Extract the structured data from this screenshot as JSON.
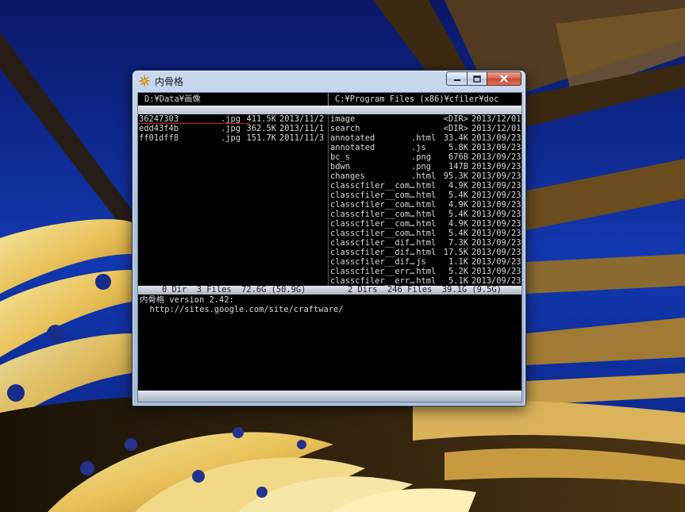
{
  "window": {
    "title": "内骨格"
  },
  "left_pane": {
    "path": "D:¥Data¥画像",
    "files": [
      {
        "name": "36247303",
        "ext": ".jpg",
        "size": "411.5K",
        "date": "2013/11/2"
      },
      {
        "name": "edd43f4b",
        "ext": ".jpg",
        "size": "362.5K",
        "date": "2013/11/1"
      },
      {
        "name": "ff01dff8",
        "ext": ".jpg",
        "size": "151.7K",
        "date": "2011/11/3"
      }
    ],
    "status": "0 Dir  3 Files  72.6G (50.9G)"
  },
  "right_pane": {
    "path": "C:¥Program Files (x86)¥cfiler¥doc",
    "files": [
      {
        "name": "image",
        "ext": "",
        "size": "<DIR>",
        "date": "2013/12/01"
      },
      {
        "name": "search",
        "ext": "",
        "size": "<DIR>",
        "date": "2013/12/01"
      },
      {
        "name": "annotated",
        "ext": ".html",
        "size": "33.4K",
        "date": "2013/09/23"
      },
      {
        "name": "annotated",
        "ext": ".js",
        "size": "5.8K",
        "date": "2013/09/23"
      },
      {
        "name": "bc_s",
        "ext": ".png",
        "size": "676B",
        "date": "2013/09/23"
      },
      {
        "name": "bdwn",
        "ext": ".png",
        "size": "147B",
        "date": "2013/09/23"
      },
      {
        "name": "changes",
        "ext": ".html",
        "size": "95.3K",
        "date": "2013/09/23"
      },
      {
        "name": "classcfiler__com…",
        "ext": ".html",
        "size": "4.9K",
        "date": "2013/09/23"
      },
      {
        "name": "classcfiler__com…",
        "ext": ".html",
        "size": "5.4K",
        "date": "2013/09/23"
      },
      {
        "name": "classcfiler__com…",
        "ext": ".html",
        "size": "4.9K",
        "date": "2013/09/23"
      },
      {
        "name": "classcfiler__com…",
        "ext": ".html",
        "size": "5.4K",
        "date": "2013/09/23"
      },
      {
        "name": "classcfiler__com…",
        "ext": ".html",
        "size": "4.9K",
        "date": "2013/09/23"
      },
      {
        "name": "classcfiler__com…",
        "ext": ".html",
        "size": "5.4K",
        "date": "2013/09/23"
      },
      {
        "name": "classcfiler__dif…",
        "ext": ".html",
        "size": "7.3K",
        "date": "2013/09/23"
      },
      {
        "name": "classcfiler__dif…",
        "ext": ".html",
        "size": "17.5K",
        "date": "2013/09/23"
      },
      {
        "name": "classcfiler__dif…",
        "ext": ".js",
        "size": "1.1K",
        "date": "2013/09/23"
      },
      {
        "name": "classcfiler__err…",
        "ext": ".html",
        "size": "5.2K",
        "date": "2013/09/23"
      },
      {
        "name": "classcfiler__err…",
        "ext": ".html",
        "size": "5.1K",
        "date": "2013/09/23"
      }
    ],
    "status": "2 Dirs  246 Files  39.1G (9.5G)"
  },
  "log": {
    "lines": [
      "内骨格 version 2.42:",
      "  http://sites.google.com/site/craftware/"
    ]
  },
  "icons": {
    "app": "sun-icon",
    "minimize": "minimize-icon",
    "maximize": "maximize-icon",
    "close": "close-icon"
  }
}
